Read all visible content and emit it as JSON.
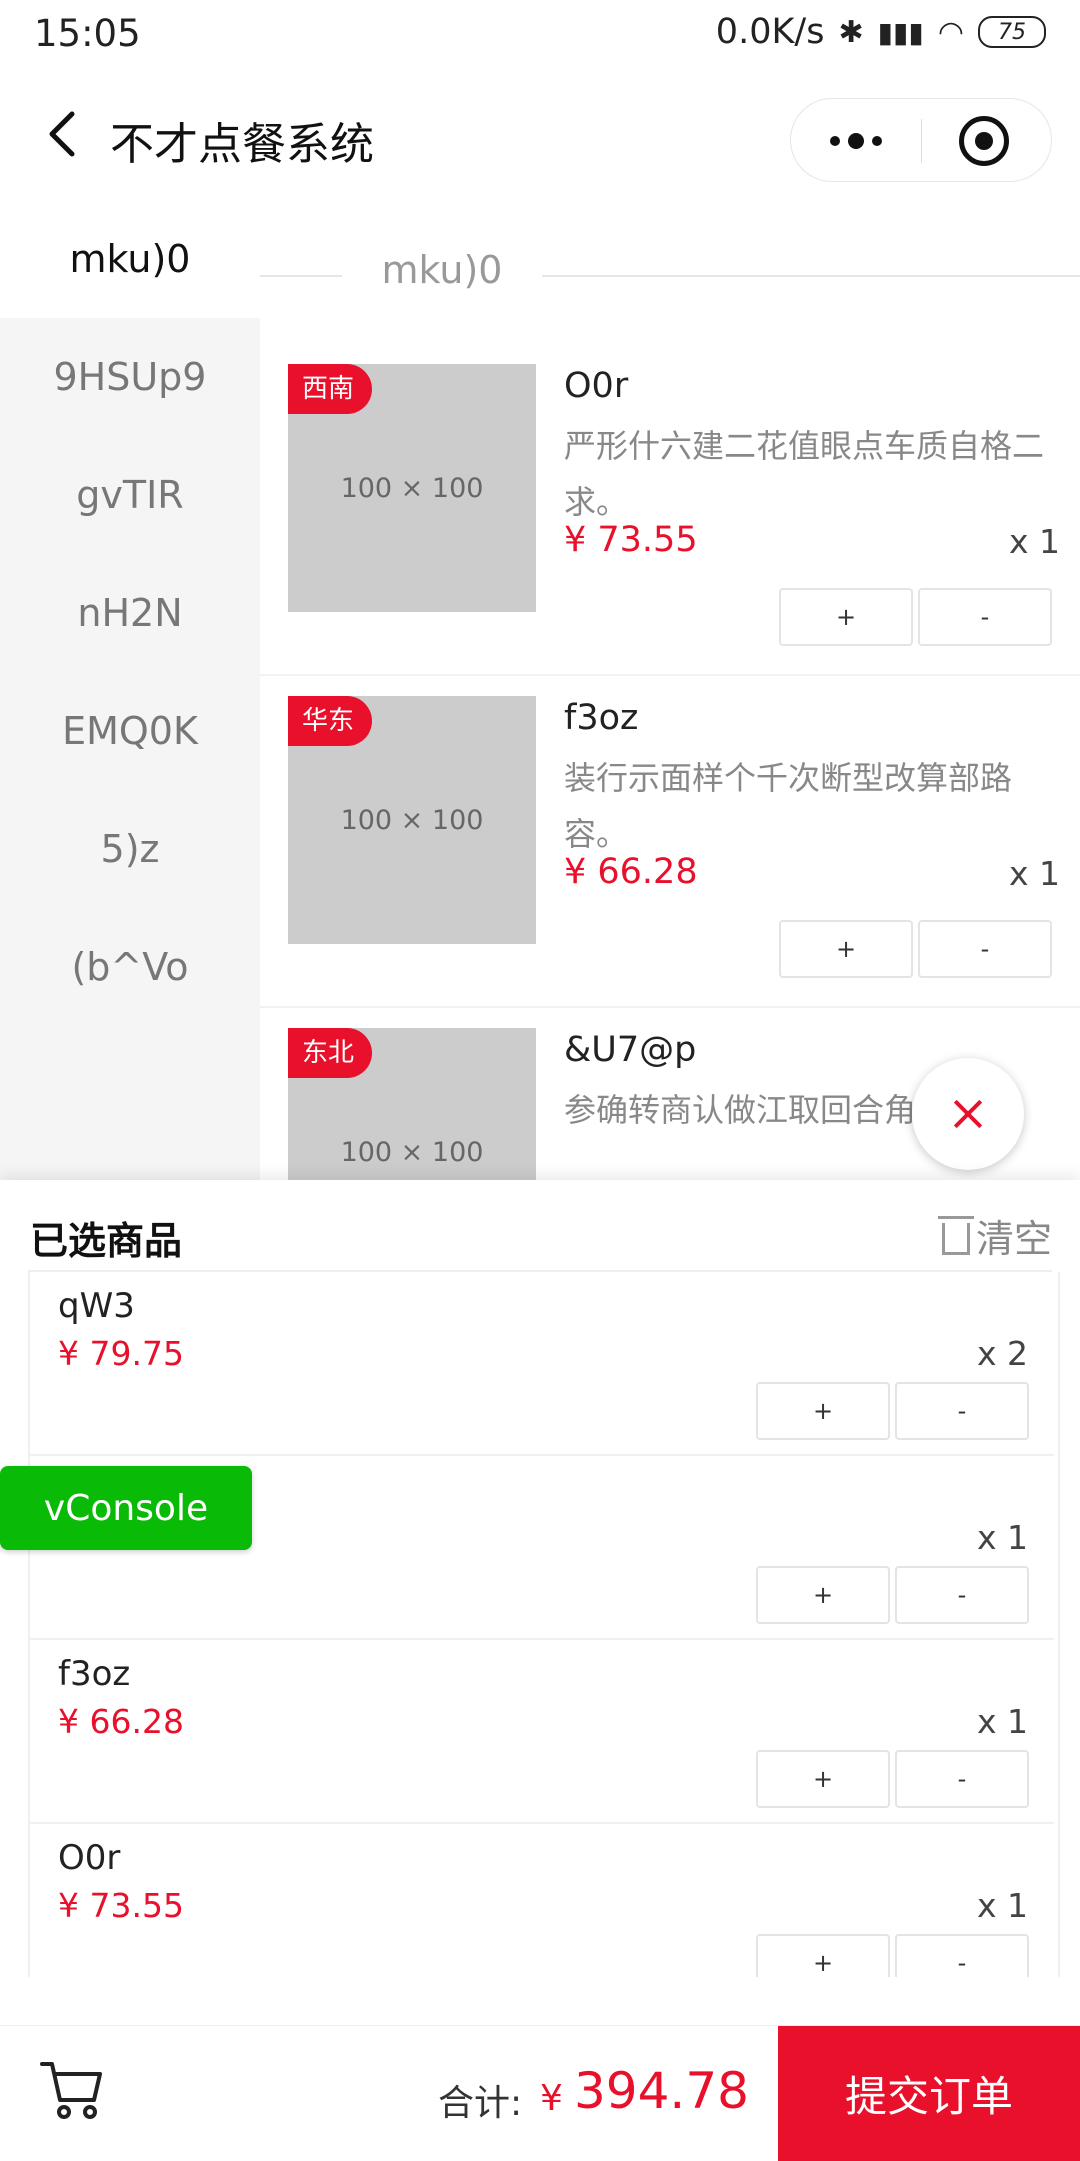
{
  "status_bar": {
    "time": "15:05",
    "network_speed": "0.0K/s",
    "battery": "75"
  },
  "nav": {
    "title": "不才点餐系统"
  },
  "sidebar": {
    "items": [
      {
        "label": "mku)0",
        "active": true
      },
      {
        "label": "9HSUp9"
      },
      {
        "label": "gvTIR"
      },
      {
        "label": "nH2N"
      },
      {
        "label": "EMQ0K"
      },
      {
        "label": "5)z"
      },
      {
        "label": "(b^Vo"
      }
    ]
  },
  "content": {
    "section_title": "mku)0",
    "products": [
      {
        "tag": "西南",
        "thumb": "100 × 100",
        "name": "O0r",
        "desc": "严形什六建二花值眼点车质自格二求。",
        "price": "¥ 73.55",
        "qty": "x 1"
      },
      {
        "tag": "华东",
        "thumb": "100 × 100",
        "name": "f3oz",
        "desc": "装行示面样个千次断型改算部路容。",
        "price": "¥ 66.28",
        "qty": "x 1"
      },
      {
        "tag": "东北",
        "thumb": "100 × 100",
        "name": "&U7@p",
        "desc": "参确转商认做江取回合角济王。",
        "price": "",
        "qty": ""
      }
    ],
    "plus_label": "+",
    "minus_label": "-"
  },
  "selected": {
    "title": "已选商品",
    "clear_label": "清空",
    "items": [
      {
        "name": "qW3",
        "price": "¥ 79.75",
        "qty": "x 2"
      },
      {
        "name": "",
        "price": "",
        "qty": "x 1"
      },
      {
        "name": "f3oz",
        "price": "¥ 66.28",
        "qty": "x 1"
      },
      {
        "name": "O0r",
        "price": "¥ 73.55",
        "qty": "x 1"
      }
    ]
  },
  "vconsole": {
    "label": "vConsole"
  },
  "bottom": {
    "total_label": "合计:",
    "currency": "¥",
    "total_value": "394.78",
    "submit_label": "提交订单"
  },
  "colors": {
    "accent": "#e8102b",
    "vconsole": "#09bb07",
    "sidebar_bg": "#f5f5f5"
  },
  "icons": [
    "back-arrow-icon",
    "more-dots-icon",
    "target-icon",
    "close-icon",
    "trash-icon",
    "cart-icon"
  ]
}
